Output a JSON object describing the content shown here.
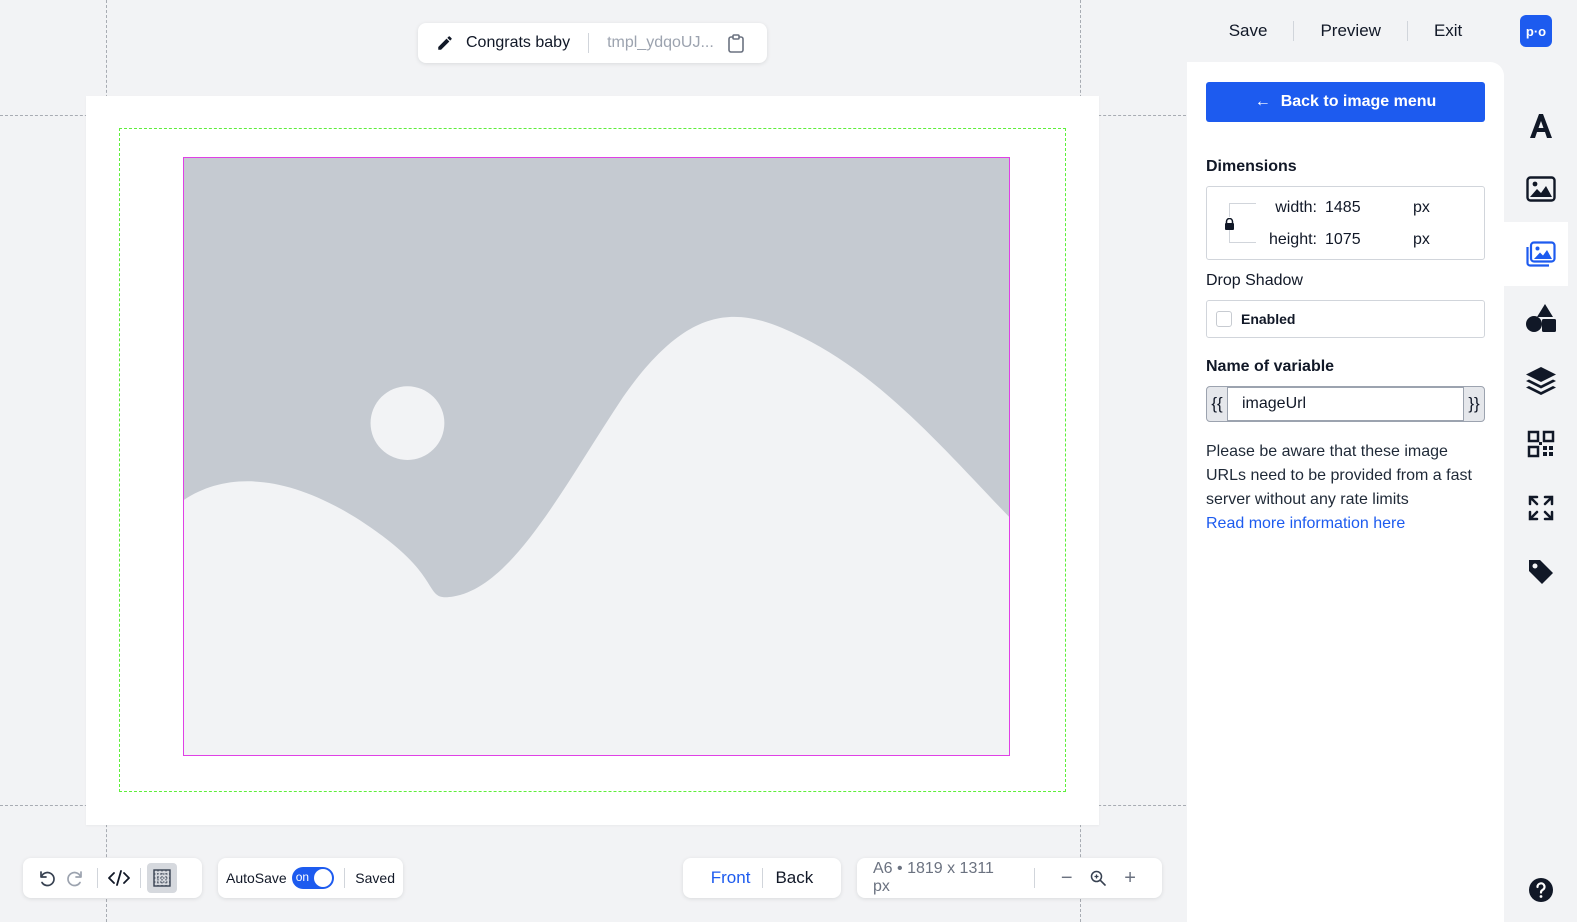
{
  "header": {
    "template_name": "Congrats baby",
    "template_id": "tmpl_ydqoUJ..."
  },
  "toolbar": {
    "autosave_label": "AutoSave",
    "toggle_text": "on",
    "status": "Saved"
  },
  "sides": {
    "front": "Front",
    "back": "Back",
    "active": "Front"
  },
  "zoom": {
    "size_label": "A6 • 1819 x 1311 px",
    "minus": "−",
    "plus": "+"
  },
  "panel": {
    "actions": {
      "save": "Save",
      "preview": "Preview",
      "exit": "Exit"
    },
    "back_button": "Back to image menu",
    "back_arrow": "←",
    "dimensions": {
      "title": "Dimensions",
      "width_label": "width:",
      "width_value": "1485",
      "height_label": "height:",
      "height_value": "1075",
      "unit": "px"
    },
    "drop_shadow": {
      "title": "Drop Shadow",
      "checkbox_label": "Enabled",
      "enabled": false
    },
    "variable": {
      "title": "Name of variable",
      "open_brace": "{{",
      "close_brace": "}}",
      "value": "imageUrl"
    },
    "notice": "Please be aware that these image URLs need to be provided from a fast server without any rate limits",
    "link": "Read more information here"
  },
  "rail": {
    "logo": "p·o",
    "items": [
      "text-icon",
      "image-icon",
      "image-variable-icon",
      "shapes-icon",
      "layers-icon",
      "qr-code-icon",
      "expand-icon",
      "tag-icon",
      "help-icon"
    ],
    "active": "image-variable-icon"
  },
  "colors": {
    "accent": "#1d5bef",
    "safe_area": "#5df03a",
    "selection": "#e040e6",
    "placeholder": "#c5cad1"
  }
}
